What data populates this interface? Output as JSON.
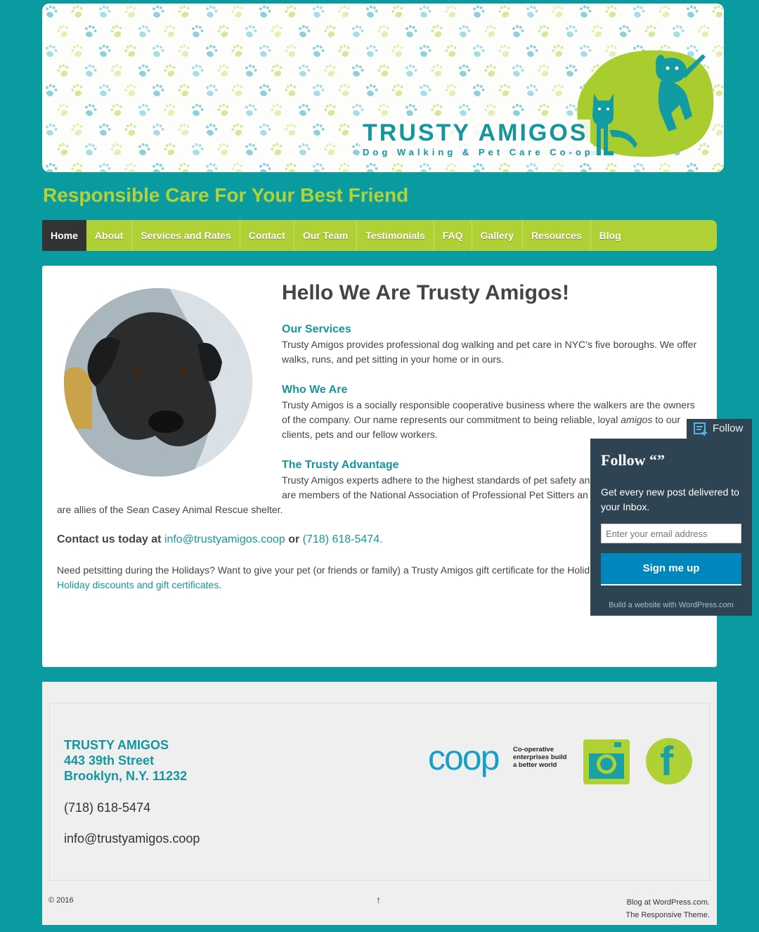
{
  "header": {
    "logo_title": "TRUSTY AMIGOS",
    "logo_subtitle": "Dog Walking & Pet Care Co-op",
    "tagline": "Responsible Care For Your Best Friend"
  },
  "nav": {
    "items": [
      "Home",
      "About",
      "Services and Rates",
      "Contact",
      "Our Team",
      "Testimonials",
      "FAQ",
      "Gallery",
      "Resources",
      "Blog"
    ],
    "active": "Home"
  },
  "content": {
    "title": "Hello We Are Trusty Amigos!",
    "services_heading": "Our Services",
    "services_text": "Trusty Amigos provides professional dog walking and pet care in NYC’s five boroughs. We offer walks, runs, and pet sitting in your home or in ours.",
    "who_heading": "Who We Are",
    "who_text_1": "Trusty Amigos is a socially responsible cooperative business where the walkers are the owners of the company. Our name represents our commitment to being reliable, loyal ",
    "who_text_em": "amigos",
    "who_text_2": " to our clients, pets and our fellow workers.",
    "advantage_heading": "The Trusty Advantage",
    "advantage_line_1": "Trusty Amigos experts adhere to the highest standards of pet safety an",
    "advantage_line_2": "are members of the National Association of Professional Pet Sitters an",
    "advantage_line_3": "are allies of the Sean Casey Animal Rescue shelter.",
    "contact_prefix": "Contact us today at ",
    "contact_email": "info@trustyamigos.coop",
    "contact_or": " or ",
    "contact_phone": "(718) 618-5474",
    "contact_period": ".",
    "holiday_text": "Need petsitting during the Holidays? Want to give your pet (or friends or family) a Trusty Amigos gift certificate for the Holid",
    "holiday_link": "Holiday discounts and gift certificates",
    "holiday_end": "."
  },
  "follow": {
    "tab_label": "Follow",
    "title": "Follow “”",
    "description": "Get every new post delivered to your Inbox.",
    "email_placeholder": "Enter your email address",
    "signup_label": "Sign me up",
    "wordpress_link": "Build a website with WordPress.com"
  },
  "footer": {
    "name": "TRUSTY AMIGOS",
    "street": "443 39th Street",
    "city": "Brooklyn, N.Y. 11232",
    "phone": "(718) 618-5474",
    "email": "info@trustyamigos.coop",
    "coop_word": "coop",
    "coop_line_1": "Co-operative",
    "coop_line_2": "enterprises build",
    "coop_line_3": "a better world",
    "facebook_letter": "f",
    "copyright": "© 2016",
    "up_arrow": "↑",
    "credit_1": "Blog at WordPress.com.",
    "credit_2": "The Responsive Theme."
  },
  "colors": {
    "background": "#0a9ba0",
    "accent_green": "#afd136",
    "teal_text": "#15959c",
    "follow_bg": "#2e4453",
    "signup_blue": "#0087be"
  },
  "icons": [
    "paw-pattern",
    "cat-and-dog-logo",
    "dog-photo",
    "follow-icon",
    "coop-logo",
    "instagram-icon",
    "facebook-icon",
    "up-arrow-icon"
  ]
}
